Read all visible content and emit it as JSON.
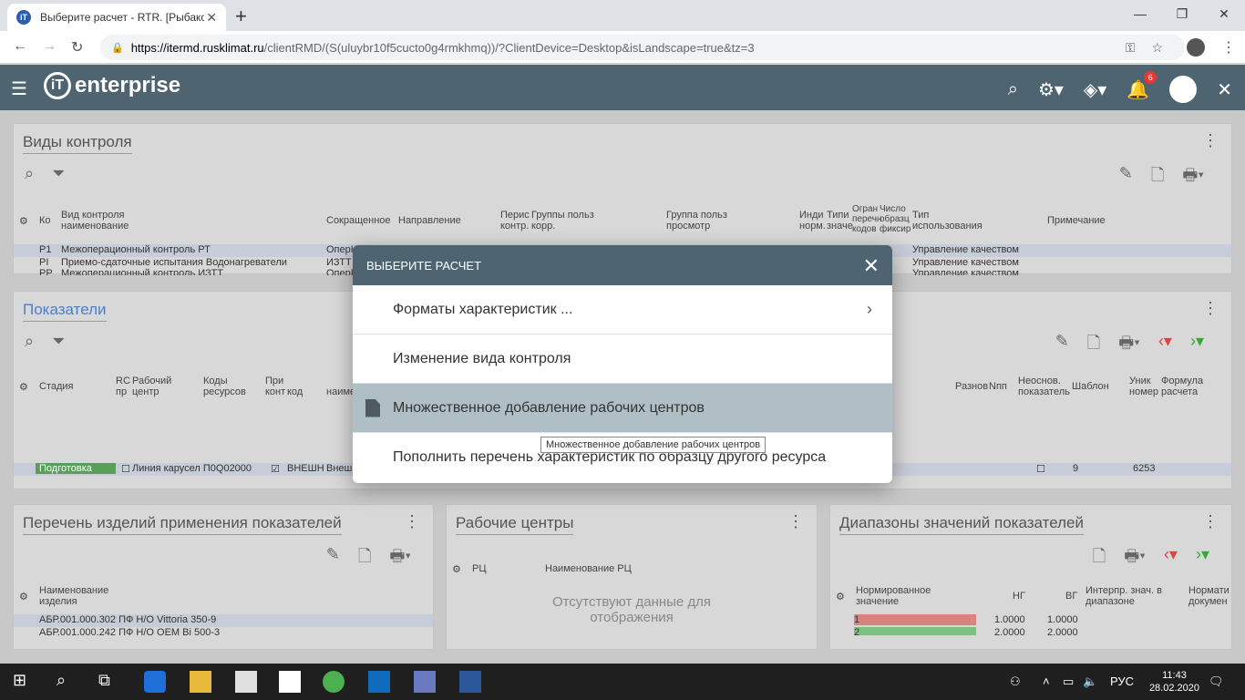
{
  "browser": {
    "tab_title": "Выберите расчет - RTR. [Рыбако",
    "url_host": "https://itermd.rusklimat.ru",
    "url_path": "/clientRMD/(S(uluybr10f5cucto0g4rmkhmq))/?ClientDevice=Desktop&isLandscape=true&tz=3"
  },
  "app": {
    "logo_text": "enterprise",
    "notif_count": "6"
  },
  "panel1": {
    "title": "Виды контроля",
    "headers": [
      "Ко",
      "Вид контроля наименование",
      "Сокращенное",
      "Направление",
      "Перис контр.",
      "Группы польз корр.",
      "Группа польз просмотр",
      "Инди норм.",
      "Типи значе",
      "Огран перечн кодов",
      "Число образц фиксир",
      "Тип использования",
      "Примечание"
    ],
    "rows": [
      {
        "code": "Р1",
        "name": "Межоперационный контроль РТ",
        "short": "ОперК",
        "usage": "Управление качеством"
      },
      {
        "code": "PI",
        "name": "Приемо-сдаточные испытания Водонагреватели",
        "short": "ИЗТТ",
        "usage": "Управление качеством"
      },
      {
        "code": "РР",
        "name": "Межоперационный контроль ИЗТТ",
        "short": "ОперК",
        "usage": "Управление качеством"
      }
    ]
  },
  "panel2": {
    "title": "Показатели",
    "headers": [
      "Стадия",
      "RC пр",
      "Рабочий центр",
      "Коды ресурсов",
      "При конт",
      "код",
      "наиме",
      "Разнов",
      "Nпп",
      "Неоснов. показатель",
      "Шаблон",
      "Уник номер",
      "Формула расчета"
    ],
    "row": {
      "stage": "Подготовка",
      "wc": "Линия карусел П0Q02000",
      "code": "ВНЕШН",
      "name": "Внеш",
      "template": "9",
      "number": "6253"
    }
  },
  "panel3": {
    "title": "Перечень изделий применения показателей",
    "header": "Наименование изделия",
    "rows": [
      "АБР.001.000.302 ПФ Н/О Vittoria 350-9",
      "АБР.001.000.242 ПФ Н/О OEM Bi 500-3"
    ]
  },
  "panel4": {
    "title": "Рабочие центры",
    "headers": [
      "РЦ",
      "Наименование РЦ"
    ],
    "empty": "Отсутствуют данные для отображения"
  },
  "panel5": {
    "title": "Диапазоны значений показателей",
    "headers": [
      "Нормированное значение",
      "НГ",
      "ВГ",
      "Интерпр. знач. в диапазоне",
      "Нормати докумен"
    ],
    "rows": [
      {
        "v": "1",
        "ng": "1.0000",
        "vg": "1.0000"
      },
      {
        "v": "2",
        "ng": "2.0000",
        "vg": "2.0000"
      }
    ]
  },
  "dialog": {
    "title": "ВЫБЕРИТЕ РАСЧЕТ",
    "items": [
      "Форматы характеристик ...",
      "Изменение вида контроля",
      "Множественное добавление рабочих центров",
      "Пополнить перечень характеристик по образцу другого ресурса"
    ],
    "tooltip": "Множественное добавление рабочих центров"
  },
  "taskbar": {
    "lang": "РУС",
    "time": "11:43",
    "date": "28.02.2020"
  }
}
